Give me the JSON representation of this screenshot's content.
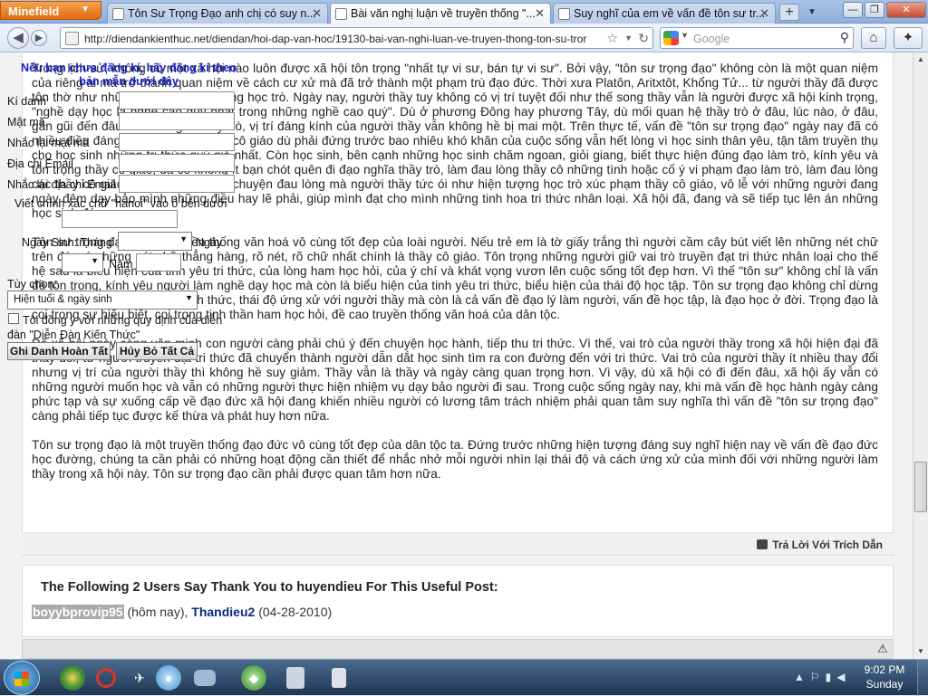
{
  "browser": {
    "app_button": "Minefield",
    "tabs": [
      {
        "title": "Tôn Sư Trọng Đạo anh chị có suy n...",
        "active": false
      },
      {
        "title": "Bài văn nghị luận về truyền thống \"...",
        "active": true
      },
      {
        "title": "Suy nghĩ của em về vấn đề tôn sư tr...",
        "active": false
      }
    ],
    "new_tab": "+",
    "url": "http://diendankienthuc.net/diendan/hoi-dap-van-hoc/19130-bai-van-nghi-luan-ve-truyen-thong-ton-su-tror",
    "search_engine": "Google",
    "search_placeholder": "Google"
  },
  "registration": {
    "heading": "Nếu bạn chưa đăng kí, hãy đăng kí theo bản mẫu dưới đây",
    "labels": {
      "username": "Kí danh",
      "password": "Mật mã",
      "password_confirm": "Nhắc lại mật mã",
      "email": "Địa chỉ Email",
      "email_confirm": "Nhắc lại địa chỉ Email",
      "captcha": "Viết chính xác chữ \"hanoi\" vào ô bên dưới",
      "birthday": "Ngày Sinh: Tháng",
      "day": "Ngày",
      "year": "Năm",
      "options": "Tùy chọn:",
      "agree": "Tôi đồng ý với những quy định của diễn đàn \"Diễn Đàn Kiến Thức\""
    },
    "options_selected": "Hiện tuổi & ngày sinh",
    "submit_button": "Ghi Danh Hoàn Tất",
    "reset_button": "Hủy Bỏ Tất Cả"
  },
  "post": {
    "paragraphs": [
      "Trong lịch sử, không có một xã hội nào luôn được xã hội tôn trọng \"nhất tự vi sư, bán tự vi sư\". Bởi vậy, \"tôn sư trọng đạo\" không còn là một quan niệm của riêng ai mà trở thành quan niệm về cách cư xử mà đã trở thành một phạm trù đạo đức. Thời xưa Platôn, Aritxtôt, Khổng Tử... từ người thầy đã được tôn thờ như những vị thánh trong lòng học trò. Ngày nay, người thầy tuy không có vị trí tuyệt đối như thế song thầy vẫn là người được xã hội kính trọng, \"nghề dạy học là nghề cao quý nhất trong những nghề cao quý\". Dù ở phương Đông hay phương Tây, dù mối quan hệ thầy trò ở đâu, lúc nào, ở đâu, gần gũi đến đâu thì danh giới thầy trò, vị trí đáng kính của người thầy vẫn không hề bị mai một. Trên thực tế, vấn đề \"tôn sư trọng đạo\" ngày nay đã có nhiều điều đáng phải bàn. Các thầy cô giáo dù phải đứng trước bao nhiêu khó khăn của cuộc sống vẫn hết lòng vì học sinh thân yêu, tận tâm truyền thụ cho học sinh những tri thức quý giá nhất. Còn học sinh, bên cạnh những học sinh chăm ngoan, giỏi giang, biết thực hiện đúng đạo làm trò, kính yêu và tôn trọng thầy cô giáo, đã có không ít bạn chót quên đi đạo nghĩa thầy trò, làm đau lòng thầy cô những tình hoặc cố ý vi phạm đạo làm trò, làm đau lòng các thầy cô giáo. Đã có những câu chuyện đau lòng mà người thầy tức ói như hiện tượng học trò xúc phạm thầy cô giáo, vô lễ với những người đang ngày đêm dạy bảo mình những điều hay lẽ phải, giúp mình đạt cho mình những tinh hoa tri thức nhân loại. Xã hội đã, đang và sẽ tiếp tục lên án những học sinh đó.",
      "Tôn sư trọng đạo là một truyền thống văn hoá vô cùng tốt đẹp của loài người. Nếu trẻ em là tờ giấy trắng thì người cầm cây bút viết lên những nét chữ trên đó, có những nét chữ thẳng hàng, rõ nét, rõ chữ nhất chính là thầy cô giáo. Tôn trọng những người giữ vai trò truyền đạt tri thức nhân loại cho thế hệ sau là biểu hiện của tinh yêu tri thức, của lòng ham học hỏi, của ý chí và khát vọng vươn lên cuộc sống tốt đẹp hơn. Vì thế \"tôn sư\" không chỉ là vấn đề tôn trọng, kính yêu người làm nghề dạy học mà còn là biểu hiện của tinh yêu tri thức, biểu hiện của thái độ học tập. Tôn sư trọng đạo không chỉ dừng lại ở đạo làm trò, ở những hình thức, thái độ ứng xử với người thầy mà còn là cả vấn đề đạo lý làm người, vấn đề học tập, là đạo học ở đời. Trọng đạo là coi trọng sự hiếu biết, coi trọng tinh thần ham học hỏi, đề cao truyền thống văn hoá của dân tộc.",
      "Để xã hội ngày càng văn minh con người càng phải chú ý đến chuyện học hành, tiếp thu tri thức. Vì thế, vai trò của người thầy trong xã hội hiện đại đã thay đổi, từ người truyền đạt tri thức đã chuyển thành người dẫn dắt học sinh tìm ra con đường đến với tri thức. Vai trò của người thầy ít nhiều thay đổi nhưng vị trí của người thầy thì không hề suy giảm. Thầy vẫn là thầy và ngày càng quan trọng hơn. Vì vậy, dù xã hội có đi đến đâu, xã hội ấy vẫn có những người muốn học và vẫn có những người thực hiện nhiệm vụ dạy bảo người đi sau. Trong cuộc sống ngày nay, khi mà vấn đề học hành ngày càng phức tạp và sự xuống cấp về đạo đức xã hội đang khiến nhiều người có lương tâm trách nhiệm phải quan tâm suy nghĩa thì vấn đề \"tôn sư trọng đạo\" càng phải tiếp tục được kế thừa và phát huy hơn nữa.",
      "Tôn sư trọng đạo là một truyền thống đạo đức vô cùng tốt đẹp của dân tộc ta. Đứng trước những hiện tượng đáng suy nghĩ hiện nay về vấn đề đạo đức học đường, chúng ta cần phải có những hoạt động cần thiết để nhắc nhở mỗi người nhìn lại thái độ và cách ứng xử của mình đối với những người làm thầy trong xã hội này. Tôn sư trọng đạo cần phải được quan tâm hơn nữa."
    ],
    "reply_quote": "Trả Lời Với Trích Dẫn"
  },
  "thanks": {
    "title": "The Following 2 Users Say Thank You to huyendieu For This Useful Post:",
    "user1": "boyybprovip95",
    "user1_date": " (hôm nay), ",
    "user2": "Thandieu2",
    "user2_date": " (04-28-2010)"
  },
  "taskbar": {
    "time": "9:02 PM",
    "day": "Sunday"
  }
}
